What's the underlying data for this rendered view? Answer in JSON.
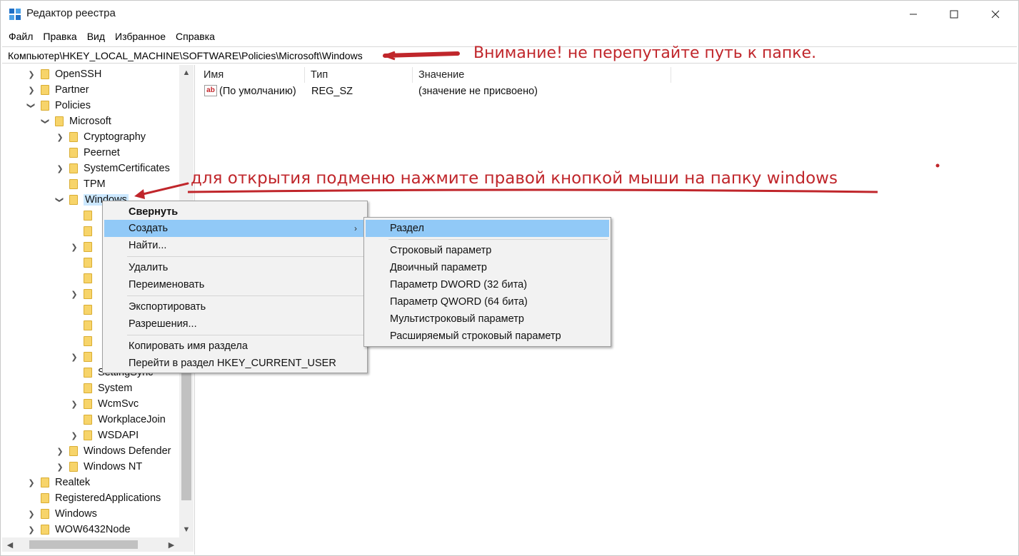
{
  "window": {
    "title": "Редактор реестра",
    "icons": {
      "app": "registry-editor-icon",
      "minimize": "minimize-icon",
      "maximize": "maximize-icon",
      "close": "close-icon"
    }
  },
  "menu": [
    "Файл",
    "Правка",
    "Вид",
    "Избранное",
    "Справка"
  ],
  "address": "Компьютер\\HKEY_LOCAL_MACHINE\\SOFTWARE\\Policies\\Microsoft\\Windows",
  "annotations": {
    "path_warning": "Внимание! не перепутайте путь к папке.",
    "right_click_hint": "для открытия подменю нажмите правой кнопкой мыши на папку windows",
    "color": "#c0262b"
  },
  "tree": {
    "items": [
      {
        "label": "OpenSSH",
        "expander": "collapsed"
      },
      {
        "label": "Partner",
        "expander": "collapsed"
      },
      {
        "label": "Policies",
        "expander": "expanded"
      },
      {
        "label": "Microsoft",
        "expander": "expanded"
      },
      {
        "label": "Cryptography",
        "expander": "collapsed"
      },
      {
        "label": "Peernet",
        "expander": "none"
      },
      {
        "label": "SystemCertificates",
        "expander": "collapsed"
      },
      {
        "label": "TPM",
        "expander": "none"
      },
      {
        "label": "Windows",
        "expander": "expanded",
        "selected": true
      },
      {
        "label": "SettingSync",
        "expander": "none"
      },
      {
        "label": "System",
        "expander": "none"
      },
      {
        "label": "WcmSvc",
        "expander": "collapsed"
      },
      {
        "label": "WorkplaceJoin",
        "expander": "none"
      },
      {
        "label": "WSDAPI",
        "expander": "collapsed"
      },
      {
        "label": "Windows Defender",
        "expander": "collapsed"
      },
      {
        "label": "Windows NT",
        "expander": "collapsed"
      },
      {
        "label": "Realtek",
        "expander": "collapsed"
      },
      {
        "label": "RegisteredApplications",
        "expander": "none"
      },
      {
        "label": "Windows",
        "expander": "collapsed"
      },
      {
        "label": "WOW6432Node",
        "expander": "collapsed"
      }
    ]
  },
  "list": {
    "columns": [
      "Имя",
      "Тип",
      "Значение"
    ],
    "rows": [
      {
        "name": "(По умолчанию)",
        "type": "REG_SZ",
        "value": "(значение не присвоено)",
        "icon": "string-value-icon"
      }
    ]
  },
  "context_menu": {
    "items": [
      {
        "label": "Свернуть",
        "bold": true
      },
      {
        "label": "Создать",
        "highlight": true,
        "submenu": true
      },
      {
        "label": "Найти..."
      },
      {
        "label": "Удалить"
      },
      {
        "label": "Переименовать"
      },
      {
        "label": "Экспортировать"
      },
      {
        "label": "Разрешения..."
      },
      {
        "label": "Копировать имя раздела"
      },
      {
        "label": "Перейти в раздел HKEY_CURRENT_USER"
      }
    ]
  },
  "submenu": {
    "items": [
      {
        "label": "Раздел",
        "highlight": true
      },
      {
        "label": "Строковый параметр"
      },
      {
        "label": "Двоичный параметр"
      },
      {
        "label": "Параметр DWORD (32 бита)"
      },
      {
        "label": "Параметр QWORD (64 бита)"
      },
      {
        "label": "Мультистроковый параметр"
      },
      {
        "label": "Расширяемый строковый параметр"
      }
    ]
  },
  "colors": {
    "highlight": "#91c9f7",
    "selection": "#cce8ff",
    "folder": "#f7d46a"
  }
}
